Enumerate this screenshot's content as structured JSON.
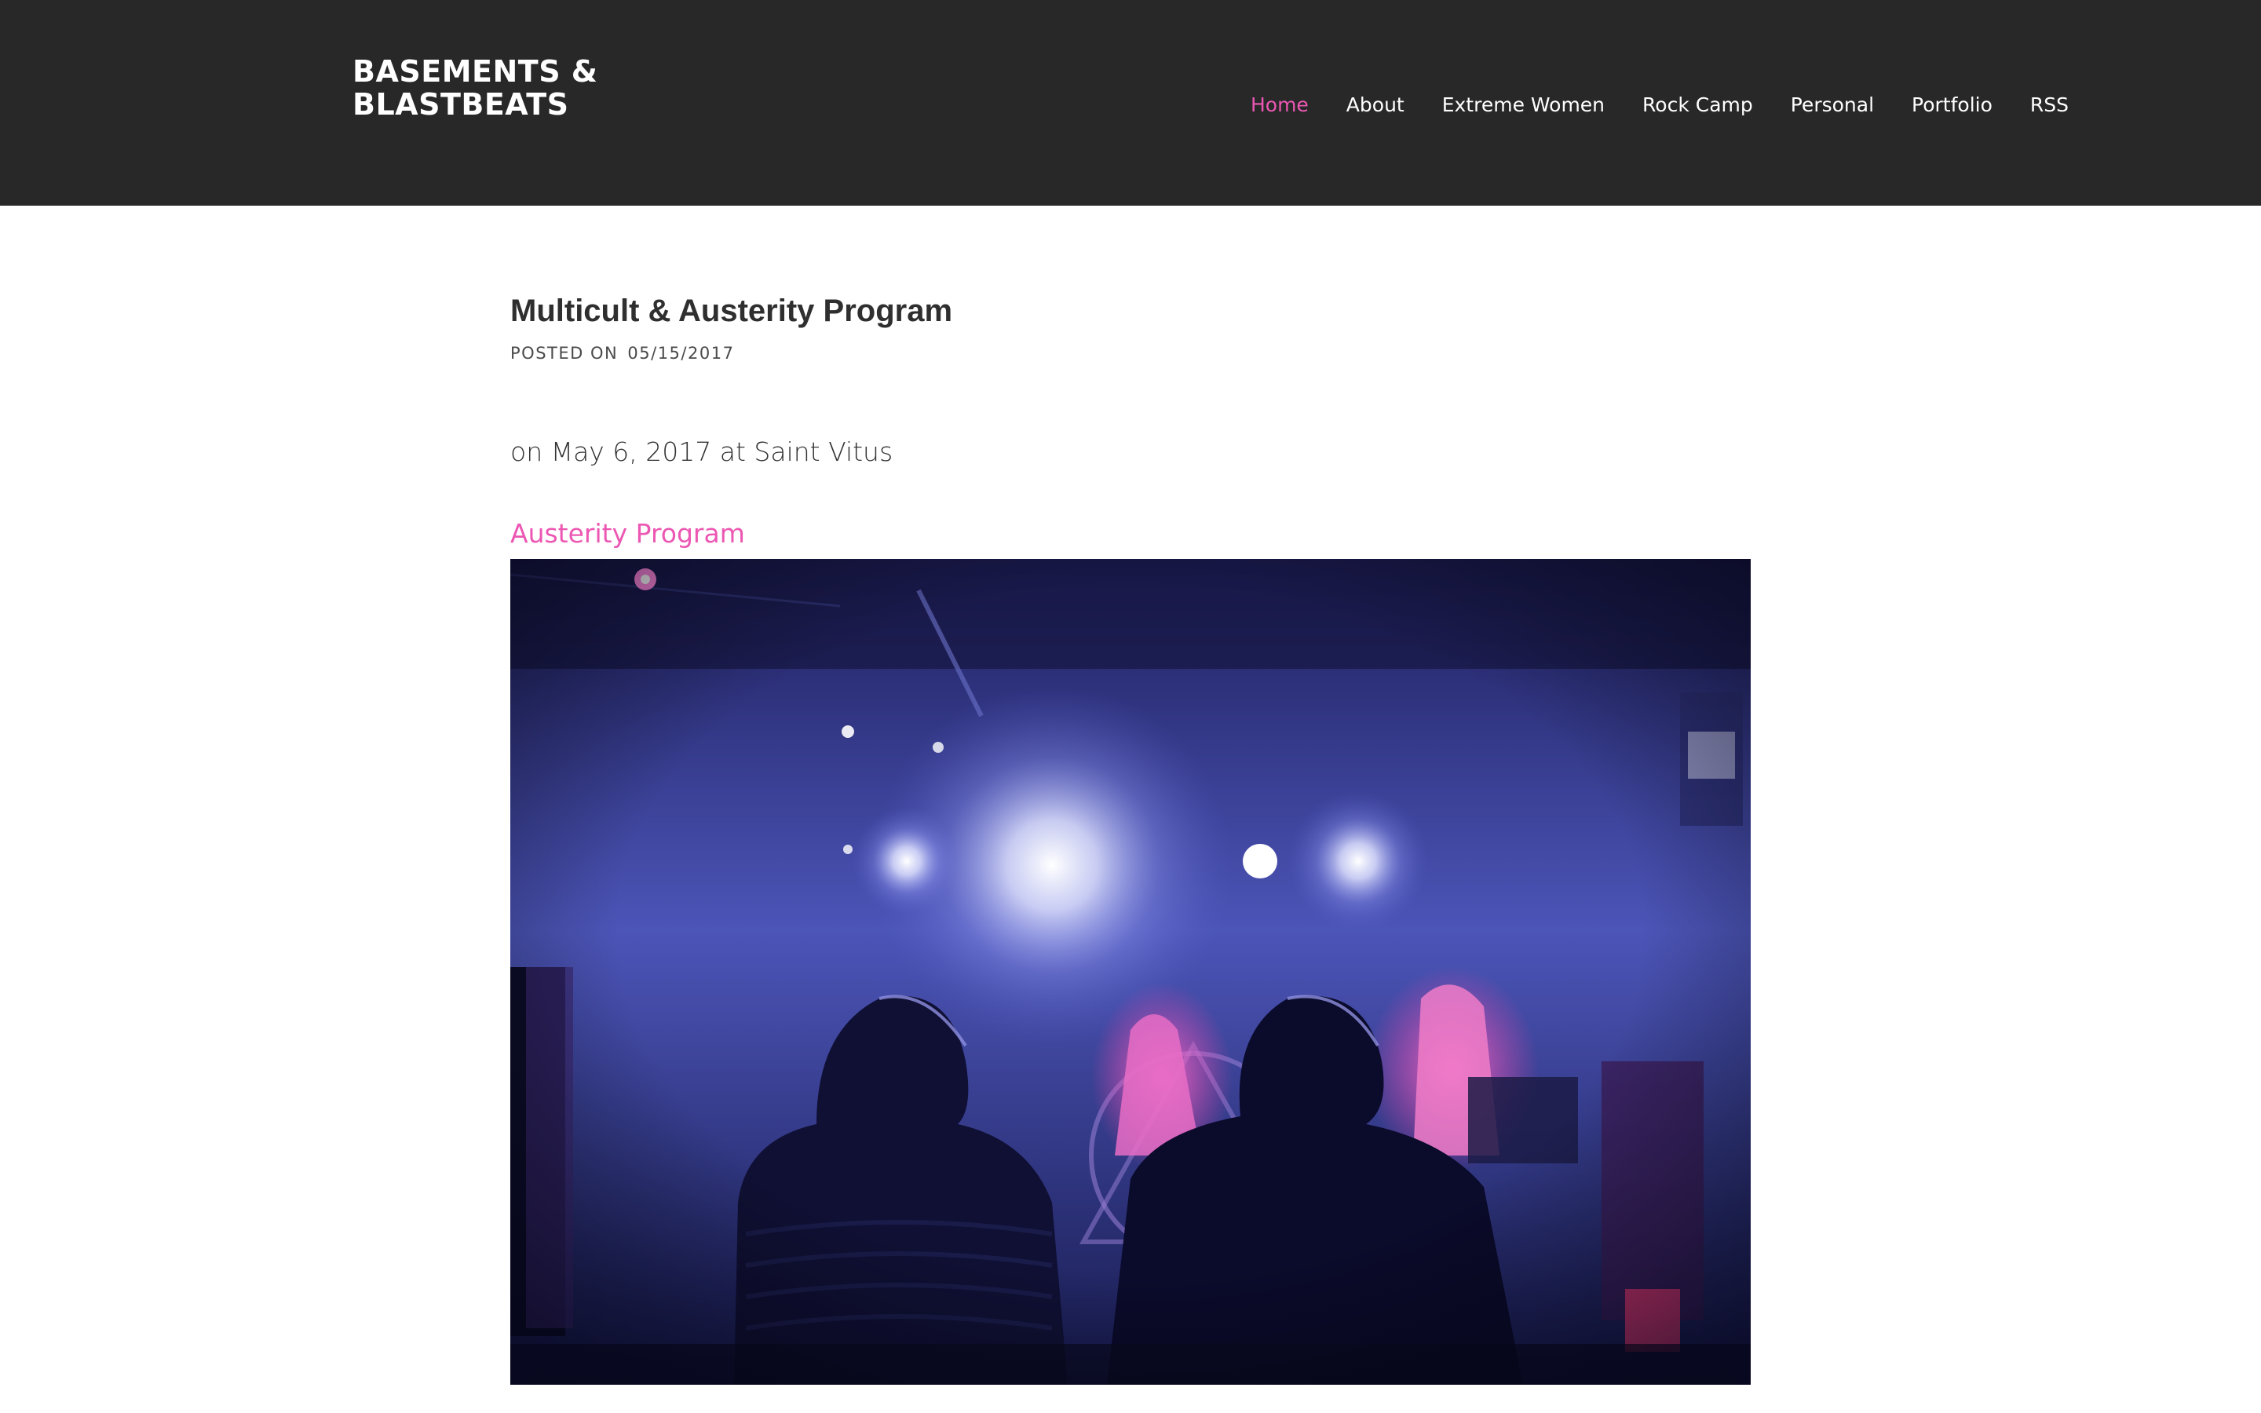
{
  "site": {
    "logo_line1": "BASEMENTS &",
    "logo_line2": "BLASTBEATS"
  },
  "nav": {
    "items": [
      {
        "label": "Home",
        "active": true
      },
      {
        "label": "About",
        "active": false
      },
      {
        "label": "Extreme Women",
        "active": false
      },
      {
        "label": "Rock Camp",
        "active": false
      },
      {
        "label": "Personal",
        "active": false
      },
      {
        "label": "Portfolio",
        "active": false
      },
      {
        "label": "RSS",
        "active": false
      }
    ]
  },
  "post": {
    "title": "Multicult & Austerity Program",
    "meta_prefix": "POSTED ON",
    "date": "05/15/2017",
    "intro": "on May 6, 2017 at Saint Vitus",
    "band_link": "Austerity Program"
  },
  "colors": {
    "header_bg": "#282828",
    "accent_pink": "#ec57b3",
    "body_text": "#333333"
  }
}
